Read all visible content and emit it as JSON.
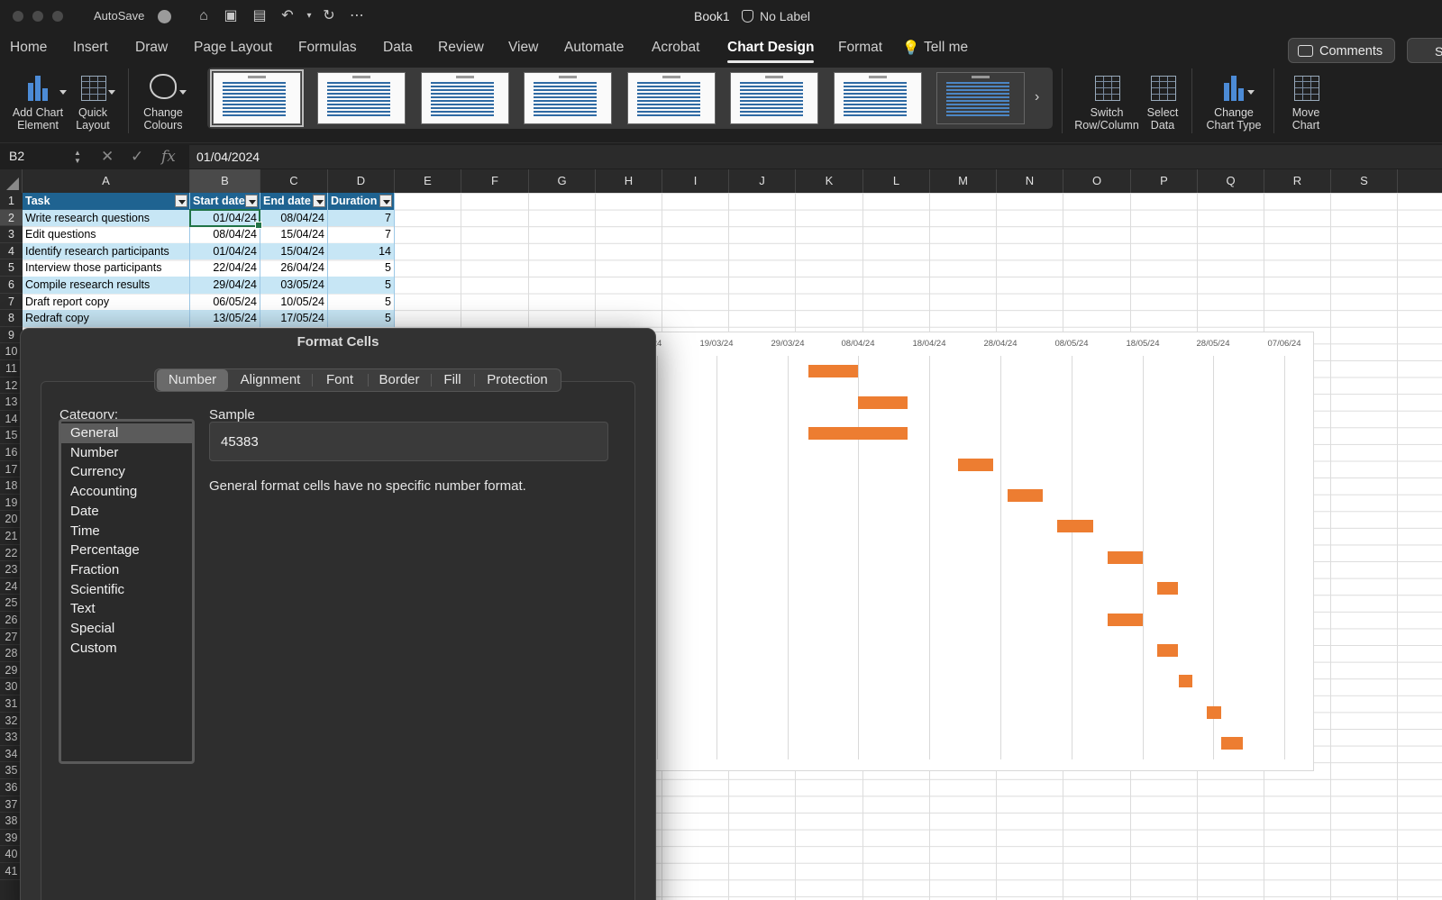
{
  "titlebar": {
    "autosave_label": "AutoSave",
    "doc_title": "Book1",
    "sensitivity": "No Label"
  },
  "ribbon_tabs": [
    "Home",
    "Insert",
    "Draw",
    "Page Layout",
    "Formulas",
    "Data",
    "Review",
    "View",
    "Automate",
    "Acrobat",
    "Chart Design",
    "Format"
  ],
  "active_tab": "Chart Design",
  "tell_me": "Tell me",
  "comments_label": "Comments",
  "share_label": "S",
  "ribbon": {
    "add_chart_element": [
      "Add Chart",
      "Element"
    ],
    "quick_layout": [
      "Quick",
      "Layout"
    ],
    "change_colours": [
      "Change",
      "Colours"
    ],
    "switch_row_column": [
      "Switch",
      "Row/Column"
    ],
    "select_data": [
      "Select",
      "Data"
    ],
    "change_chart_type": [
      "Change",
      "Chart Type"
    ],
    "move_chart": [
      "Move",
      "Chart"
    ]
  },
  "formula_bar": {
    "name_box": "B2",
    "value": "01/04/2024"
  },
  "columns": [
    "A",
    "B",
    "C",
    "D",
    "E",
    "F",
    "G",
    "H",
    "I",
    "J",
    "K",
    "L",
    "M",
    "N",
    "O",
    "P",
    "Q",
    "R",
    "S"
  ],
  "rows": [
    "1",
    "2",
    "3",
    "4",
    "5",
    "6",
    "7",
    "8",
    "9",
    "10",
    "11",
    "12",
    "13",
    "14",
    "15",
    "16",
    "17",
    "18",
    "19",
    "20",
    "21",
    "22",
    "23",
    "24",
    "25",
    "26",
    "27",
    "28",
    "29",
    "30",
    "31",
    "32",
    "33",
    "34",
    "35",
    "36",
    "37",
    "38",
    "39",
    "40",
    "41"
  ],
  "table": {
    "headers": [
      "Task",
      "Start date",
      "End date",
      "Duration"
    ],
    "rows": [
      [
        "Write research questions",
        "01/04/24",
        "08/04/24",
        "7"
      ],
      [
        "Edit questions",
        "08/04/24",
        "15/04/24",
        "7"
      ],
      [
        "Identify research participants",
        "01/04/24",
        "15/04/24",
        "14"
      ],
      [
        "Interview those participants",
        "22/04/24",
        "26/04/24",
        "5"
      ],
      [
        "Compile research results",
        "29/04/24",
        "03/05/24",
        "5"
      ],
      [
        "Draft report copy",
        "06/05/24",
        "10/05/24",
        "5"
      ],
      [
        "Redraft copy",
        "13/05/24",
        "17/05/24",
        "5"
      ]
    ]
  },
  "chart_data": {
    "type": "bar",
    "x_ticks": [
      "24",
      "19/03/24",
      "29/03/24",
      "08/04/24",
      "18/04/24",
      "28/04/24",
      "08/05/24",
      "18/05/24",
      "28/05/24",
      "07/06/24"
    ],
    "bars": [
      {
        "start": "01/04/24",
        "end": "08/04/24"
      },
      {
        "start": "08/04/24",
        "end": "15/04/24"
      },
      {
        "start": "01/04/24",
        "end": "15/04/24"
      },
      {
        "start": "22/04/24",
        "end": "27/04/24"
      },
      {
        "start": "29/04/24",
        "end": "04/05/24"
      },
      {
        "start": "06/05/24",
        "end": "11/05/24"
      },
      {
        "start": "13/05/24",
        "end": "18/05/24"
      },
      {
        "start": "20/05/24",
        "end": "23/05/24"
      },
      {
        "start": "13/05/24",
        "end": "18/05/24"
      },
      {
        "start": "20/05/24",
        "end": "23/05/24"
      },
      {
        "start": "23/05/24",
        "end": "25/05/24"
      },
      {
        "start": "27/05/24",
        "end": "29/05/24"
      },
      {
        "start": "29/05/24",
        "end": "01/06/24"
      }
    ],
    "bar_color": "#ed7d31"
  },
  "dialog": {
    "title": "Format Cells",
    "tabs": [
      "Number",
      "Alignment",
      "Font",
      "Border",
      "Fill",
      "Protection"
    ],
    "active_tab": "Number",
    "category_label": "Category:",
    "categories": [
      "General",
      "Number",
      "Currency",
      "Accounting",
      "Date",
      "Time",
      "Percentage",
      "Fraction",
      "Scientific",
      "Text",
      "Special",
      "Custom"
    ],
    "selected_category": "General",
    "sample_label": "Sample",
    "sample_value": "45383",
    "description": "General format cells have no specific number format."
  }
}
